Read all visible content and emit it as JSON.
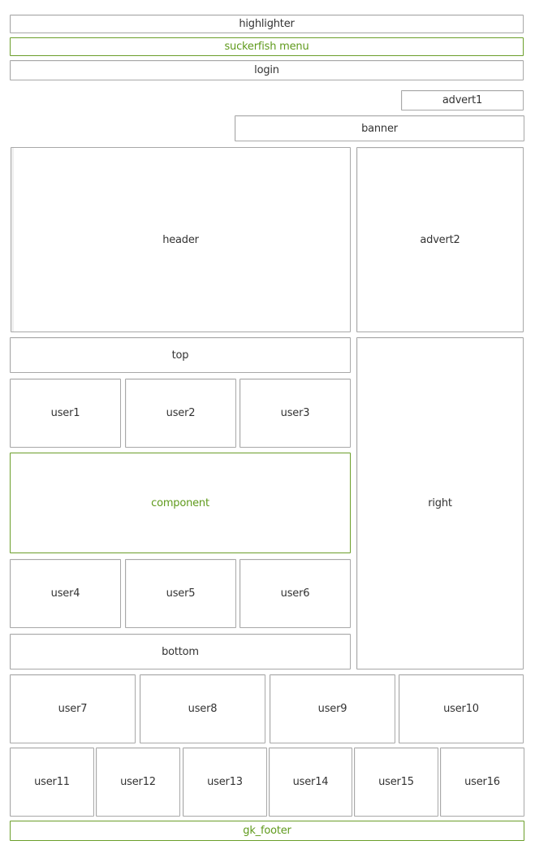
{
  "positions": {
    "highlighter": "highlighter",
    "suckerfish": "suckerfish menu",
    "login": "login",
    "advert1": "advert1",
    "banner": "banner",
    "header": "header",
    "advert2": "advert2",
    "top": "top",
    "user1": "user1",
    "user2": "user2",
    "user3": "user3",
    "component": "component",
    "user4": "user4",
    "user5": "user5",
    "user6": "user6",
    "bottom": "bottom",
    "right": "right",
    "user7": "user7",
    "user8": "user8",
    "user9": "user9",
    "user10": "user10",
    "user11": "user11",
    "user12": "user12",
    "user13": "user13",
    "user14": "user14",
    "user15": "user15",
    "user16": "user16",
    "footer": "gk_footer"
  },
  "colors": {
    "accent": "#5f9a1c",
    "border": "#a8a8a8",
    "text": "#333333"
  }
}
